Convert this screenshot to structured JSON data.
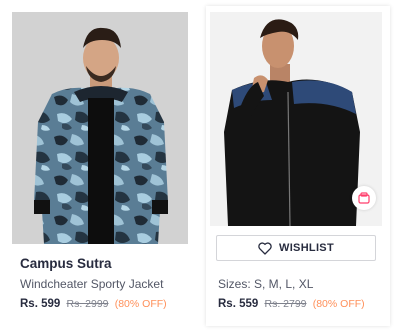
{
  "products": [
    {
      "brand": "Campus Sutra",
      "name": "Windcheater Sporty Jacket",
      "price": "Rs. 599",
      "mrp": "Rs. 2999",
      "discount": "(80% OFF)",
      "image_icon": "camo-jacket-photo"
    },
    {
      "wishlist_label": "WISHLIST",
      "sizes": "Sizes: S, M, L, XL",
      "price": "Rs. 559",
      "mrp": "Rs. 2799",
      "discount": "(80% OFF)",
      "image_icon": "black-jacket-photo",
      "similar_icon": "view-similar-icon"
    }
  ],
  "colors": {
    "discount": "#ff905a",
    "text_primary": "#282c3f",
    "text_secondary": "#535766",
    "mrp": "#7e818c",
    "similar_icon": "#ff3f6c"
  }
}
